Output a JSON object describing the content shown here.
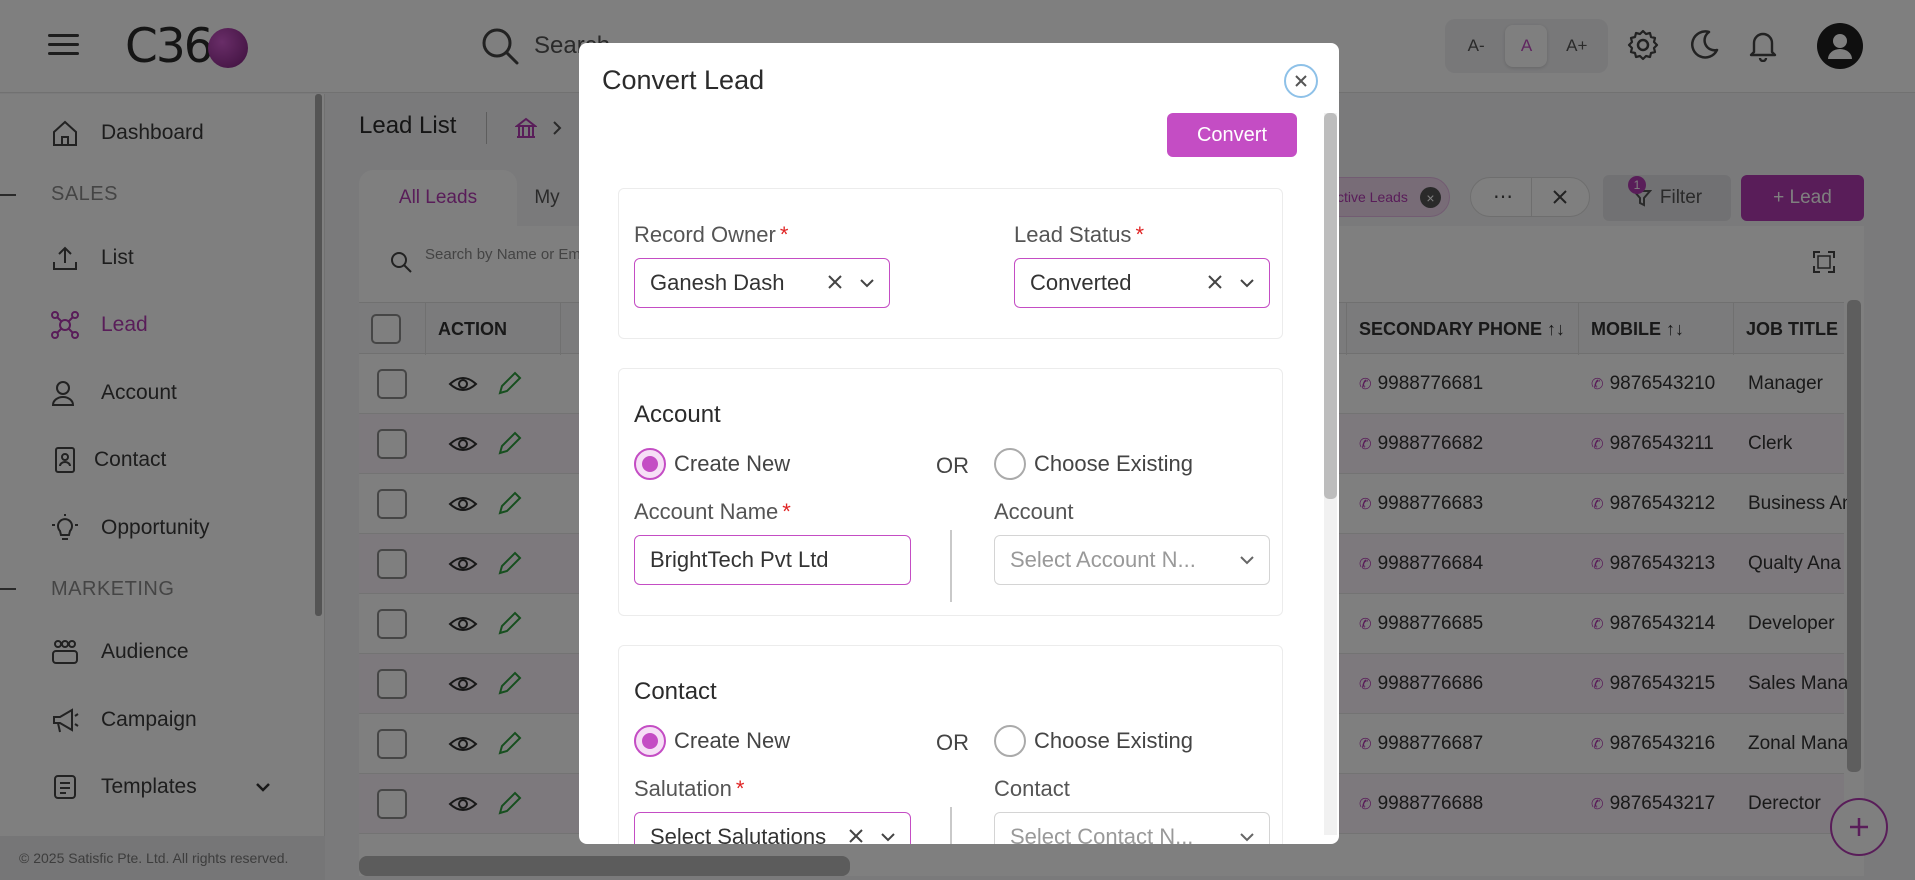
{
  "app": {
    "logo_text": "C36"
  },
  "topbar": {
    "search_placeholder": "Search",
    "font_small": "A-",
    "font_normal": "A",
    "font_large": "A+"
  },
  "sidebar": {
    "items": [
      {
        "label": "Dashboard",
        "icon": "home-icon"
      },
      {
        "label": "List",
        "icon": "upload-icon"
      },
      {
        "label": "Lead",
        "icon": "lead-network-icon"
      },
      {
        "label": "Account",
        "icon": "user-icon"
      },
      {
        "label": "Contact",
        "icon": "contact-card-icon"
      },
      {
        "label": "Opportunity",
        "icon": "bulb-icon"
      },
      {
        "label": "Audience",
        "icon": "group-icon"
      },
      {
        "label": "Campaign",
        "icon": "megaphone-icon"
      },
      {
        "label": "Templates",
        "icon": "template-icon"
      }
    ],
    "section_sales": "SALES",
    "section_marketing": "MARKETING",
    "footer": "© 2025 Satisfic Pte. Ltd. All rights reserved."
  },
  "main": {
    "page_title": "Lead List",
    "tabs": [
      {
        "label": "All Leads"
      },
      {
        "label": "My"
      }
    ],
    "chip_active": "ctive Leads",
    "filter_label": "Filter",
    "filter_count": "1",
    "add_lead_label": "+ Lead",
    "table_search_placeholder": "Search by Name or Em",
    "columns": {
      "action": "ACTION",
      "secondary_phone": "SECONDARY PHONE ↑↓",
      "mobile": "MOBILE ↑↓",
      "job_title": "JOB TITLE"
    },
    "rows": [
      {
        "secondary_phone": "9988776681",
        "mobile": "9876543210",
        "job_title": "Manager"
      },
      {
        "secondary_phone": "9988776682",
        "mobile": "9876543211",
        "job_title": "Clerk"
      },
      {
        "secondary_phone": "9988776683",
        "mobile": "9876543212",
        "job_title": "Business An"
      },
      {
        "secondary_phone": "9988776684",
        "mobile": "9876543213",
        "job_title": "Qualty Ana"
      },
      {
        "secondary_phone": "9988776685",
        "mobile": "9876543214",
        "job_title": "Developer"
      },
      {
        "secondary_phone": "9988776686",
        "mobile": "9876543215",
        "job_title": "Sales Mana"
      },
      {
        "secondary_phone": "9988776687",
        "mobile": "9876543216",
        "job_title": "Zonal Mana"
      },
      {
        "secondary_phone": "9988776688",
        "mobile": "9876543217",
        "job_title": "Derector"
      }
    ]
  },
  "modal": {
    "title": "Convert Lead",
    "convert_label": "Convert",
    "record_owner_label": "Record Owner",
    "record_owner_value": "Ganesh Dash",
    "lead_status_label": "Lead Status",
    "lead_status_value": "Converted",
    "account_section": {
      "title": "Account",
      "create_new": "Create New",
      "or": "OR",
      "choose_existing": "Choose Existing",
      "name_label": "Account Name",
      "name_value": "BrightTech Pvt Ltd",
      "existing_label": "Account",
      "existing_placeholder": "Select Account N..."
    },
    "contact_section": {
      "title": "Contact",
      "create_new": "Create New",
      "or": "OR",
      "choose_existing": "Choose Existing",
      "salutation_label": "Salutation",
      "salutation_placeholder": "Select Salutations",
      "existing_label": "Contact",
      "existing_placeholder": "Select Contact N..."
    }
  },
  "colors": {
    "accent": "#b23bb2",
    "button": "#c44dc4",
    "required": "#e02424",
    "edit_icon": "#2e9e3e"
  }
}
